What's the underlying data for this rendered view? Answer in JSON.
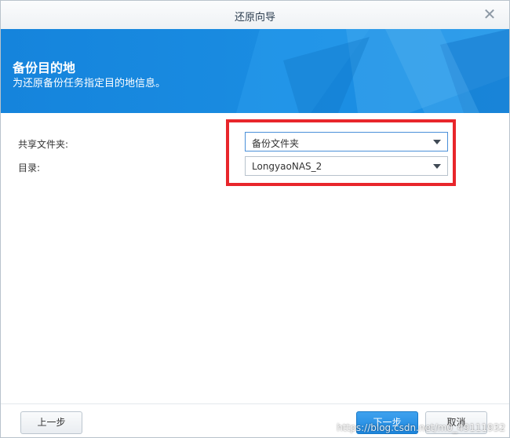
{
  "window": {
    "title": "还原向导"
  },
  "banner": {
    "heading": "备份目的地",
    "subheading": "为还原备份任务指定目的地信息。"
  },
  "form": {
    "shared_folder_label": "共享文件夹:",
    "shared_folder_value": "备份文件夹",
    "directory_label": "目录:",
    "directory_value": "LongyaoNAS_2"
  },
  "footer": {
    "prev_label": "上一步",
    "next_label": "下一步",
    "cancel_label": "取消"
  },
  "watermark": "https://blog.csdn.net/m0_49111932",
  "colors": {
    "accent": "#1a8be0",
    "highlight": "#e8262b"
  }
}
